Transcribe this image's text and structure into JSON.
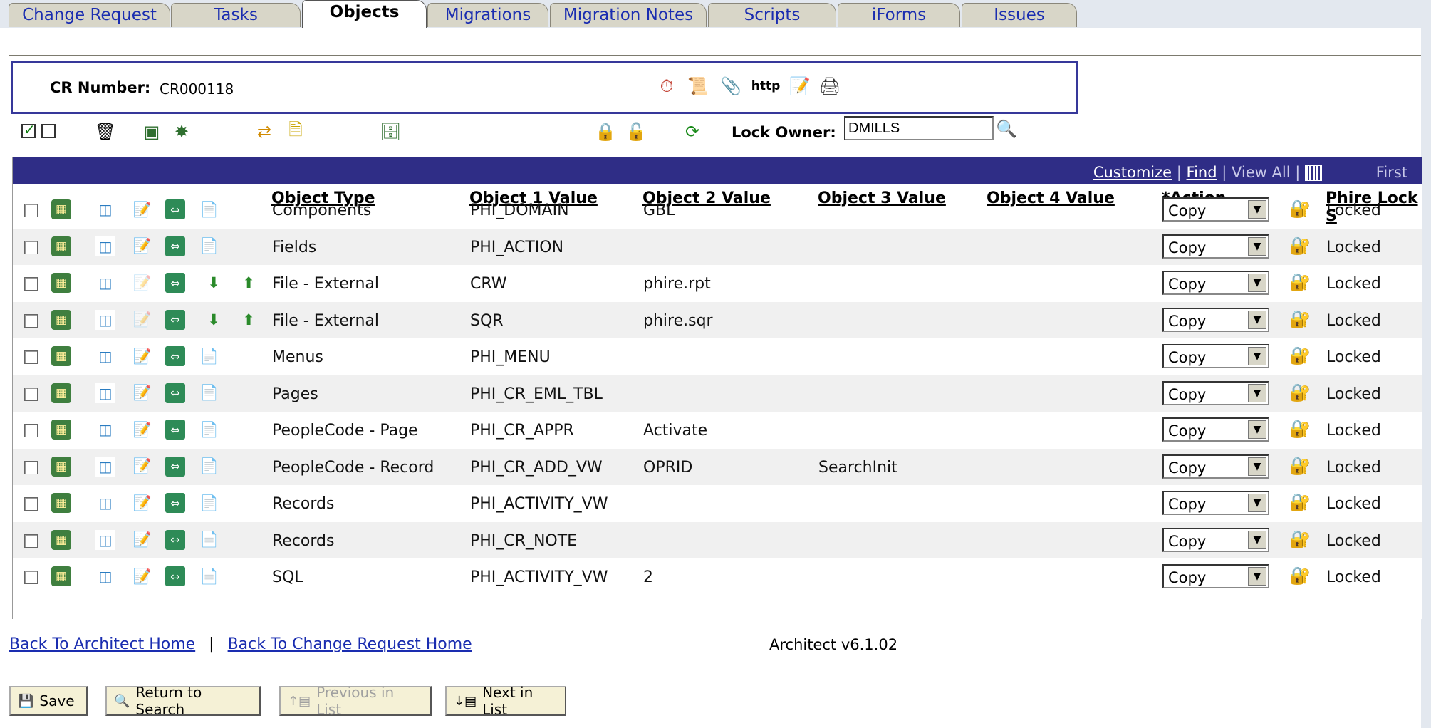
{
  "tabs": [
    {
      "label": "Change Request"
    },
    {
      "label": "Tasks"
    },
    {
      "label": "Objects",
      "active": true
    },
    {
      "label": "Migrations"
    },
    {
      "label": "Migration Notes"
    },
    {
      "label": "Scripts"
    },
    {
      "label": "iForms"
    },
    {
      "label": "Issues"
    }
  ],
  "header": {
    "cr_label": "CR Number:",
    "cr_value": "CR000118",
    "icons": [
      "history-icon",
      "scroll-icon",
      "paperclip-icon",
      "http-icon",
      "edit-form-icon",
      "printer-icon"
    ],
    "http_text": "http"
  },
  "toolbar": {
    "lock_owner_label": "Lock Owner:",
    "lock_owner_value": "DMILLS"
  },
  "grid": {
    "customize": "Customize",
    "find": "Find",
    "view_all": "View All",
    "first": "First",
    "columns": {
      "object_type": "Object Type",
      "obj1": "Object 1 Value",
      "obj2": "Object 2 Value",
      "obj3": "Object 3 Value",
      "obj4": "Object 4 Value",
      "action": "*Action",
      "phire_lock": "Phire Lock S"
    },
    "rows": [
      {
        "type": "Components",
        "v1": "PHI_DOMAIN",
        "v2": "GBL",
        "v3": "",
        "v4": "",
        "action": "Copy",
        "lock": "Locked",
        "file": false
      },
      {
        "type": "Fields",
        "v1": "PHI_ACTION",
        "v2": "",
        "v3": "",
        "v4": "",
        "action": "Copy",
        "lock": "Locked",
        "file": false
      },
      {
        "type": "File - External",
        "v1": "CRW",
        "v2": "phire.rpt",
        "v3": "",
        "v4": "",
        "action": "Copy",
        "lock": "Locked",
        "file": true
      },
      {
        "type": "File - External",
        "v1": "SQR",
        "v2": "phire.sqr",
        "v3": "",
        "v4": "",
        "action": "Copy",
        "lock": "Locked",
        "file": true
      },
      {
        "type": "Menus",
        "v1": "PHI_MENU",
        "v2": "",
        "v3": "",
        "v4": "",
        "action": "Copy",
        "lock": "Locked",
        "file": false
      },
      {
        "type": "Pages",
        "v1": "PHI_CR_EML_TBL",
        "v2": "",
        "v3": "",
        "v4": "",
        "action": "Copy",
        "lock": "Locked",
        "file": false
      },
      {
        "type": "PeopleCode - Page",
        "v1": "PHI_CR_APPR",
        "v2": "Activate",
        "v3": "",
        "v4": "",
        "action": "Copy",
        "lock": "Locked",
        "file": false
      },
      {
        "type": "PeopleCode - Record",
        "v1": "PHI_CR_ADD_VW",
        "v2": "OPRID",
        "v3": "SearchInit",
        "v4": "",
        "action": "Copy",
        "lock": "Locked",
        "file": false
      },
      {
        "type": "Records",
        "v1": "PHI_ACTIVITY_VW",
        "v2": "",
        "v3": "",
        "v4": "",
        "action": "Copy",
        "lock": "Locked",
        "file": false
      },
      {
        "type": "Records",
        "v1": "PHI_CR_NOTE",
        "v2": "",
        "v3": "",
        "v4": "",
        "action": "Copy",
        "lock": "Locked",
        "file": false
      },
      {
        "type": "SQL",
        "v1": "PHI_ACTIVITY_VW",
        "v2": "2",
        "v3": "",
        "v4": "",
        "action": "Copy",
        "lock": "Locked",
        "file": false
      }
    ]
  },
  "footer": {
    "back_architect": "Back To Architect Home",
    "separator": "|",
    "back_cr": "Back To Change Request Home",
    "version": "Architect v6.1.02"
  },
  "buttons": {
    "save": "Save",
    "return_search": "Return to Search",
    "previous": "Previous in List",
    "next": "Next in List"
  }
}
